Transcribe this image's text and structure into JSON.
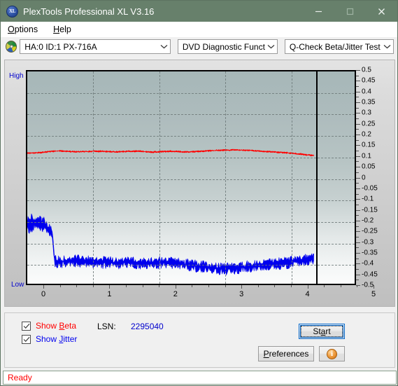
{
  "window": {
    "title": "PlexTools Professional XL V3.16",
    "icon": "XL",
    "buttons": {
      "minimize": "minimize-icon",
      "maximize": "maximize-icon",
      "close": "close-icon"
    },
    "titlebar_color": "#67806b"
  },
  "menubar": {
    "items": [
      {
        "label": "Options",
        "accel": "O"
      },
      {
        "label": "Help",
        "accel": "H"
      }
    ]
  },
  "toolbar": {
    "drive_icon": "disc-icon",
    "drive_select": "HA:0 ID:1  PX-716A",
    "function_select": "DVD Diagnostic Functions",
    "test_select": "Q-Check Beta/Jitter Test",
    "chevron": "chevron-down-icon"
  },
  "chart_data": {
    "type": "line",
    "title": "Q-Check Beta/Jitter Test",
    "xlabel": "",
    "ylabel": "",
    "xlim": [
      0,
      5
    ],
    "ylim": [
      -0.5,
      0.5
    ],
    "xticks": [
      0,
      1,
      2,
      3,
      4,
      5
    ],
    "xtick_labels": [
      "0",
      "1",
      "2",
      "3",
      "4",
      "5"
    ],
    "yticks": [
      0.5,
      0.45,
      0.4,
      0.35,
      0.3,
      0.25,
      0.2,
      0.15,
      0.1,
      0.05,
      0,
      -0.05,
      -0.1,
      -0.15,
      -0.2,
      -0.25,
      -0.3,
      -0.35,
      -0.4,
      -0.45,
      -0.5
    ],
    "ytick_labels": [
      "0.5",
      "0.45",
      "0.4",
      "0.35",
      "0.3",
      "0.25",
      "0.2",
      "0.15",
      "0.1",
      "0.05",
      "0",
      "-0.05",
      "-0.1",
      "-0.15",
      "-0.2",
      "-0.25",
      "-0.3",
      "-0.35",
      "-0.4",
      "-0.45",
      "-0.5"
    ],
    "grid": true,
    "grid_x_major": [
      1,
      2,
      3,
      4
    ],
    "grid_y_major": [
      0.4,
      0.3,
      0.2,
      0.1,
      0,
      -0.1,
      -0.2,
      -0.3,
      -0.4
    ],
    "axis_label_high": "High",
    "axis_label_low": "Low",
    "data_end_x": 4.38,
    "legend_position": "none",
    "series": [
      {
        "name": "Beta",
        "color": "#ff0000",
        "x": [
          0.0,
          0.1,
          0.2,
          0.3,
          0.4,
          0.5,
          0.6,
          0.7,
          0.8,
          0.9,
          1.0,
          1.1,
          1.2,
          1.3,
          1.4,
          1.5,
          1.6,
          1.7,
          1.8,
          1.9,
          2.0,
          2.1,
          2.2,
          2.3,
          2.4,
          2.5,
          2.6,
          2.7,
          2.8,
          2.9,
          3.0,
          3.1,
          3.2,
          3.3,
          3.4,
          3.5,
          3.6,
          3.7,
          3.8,
          3.9,
          4.0,
          4.1,
          4.2,
          4.3,
          4.38
        ],
        "values": [
          0.115,
          0.116,
          0.118,
          0.121,
          0.124,
          0.126,
          0.124,
          0.122,
          0.122,
          0.123,
          0.124,
          0.124,
          0.123,
          0.122,
          0.122,
          0.123,
          0.124,
          0.125,
          0.122,
          0.12,
          0.122,
          0.123,
          0.124,
          0.123,
          0.121,
          0.121,
          0.123,
          0.125,
          0.127,
          0.128,
          0.129,
          0.13,
          0.13,
          0.129,
          0.128,
          0.126,
          0.124,
          0.122,
          0.12,
          0.118,
          0.116,
          0.113,
          0.11,
          0.106,
          0.104
        ],
        "noise": 0.004
      },
      {
        "name": "Jitter",
        "color": "#0000ee",
        "x": [
          0.0,
          0.05,
          0.1,
          0.15,
          0.2,
          0.25,
          0.3,
          0.35,
          0.38,
          0.42,
          0.5,
          0.6,
          0.7,
          0.8,
          0.9,
          1.0,
          1.1,
          1.2,
          1.3,
          1.4,
          1.5,
          1.6,
          1.7,
          1.8,
          1.9,
          2.0,
          2.1,
          2.2,
          2.3,
          2.4,
          2.5,
          2.6,
          2.7,
          2.8,
          2.9,
          3.0,
          3.1,
          3.2,
          3.3,
          3.4,
          3.5,
          3.6,
          3.7,
          3.8,
          3.9,
          4.0,
          4.1,
          4.2,
          4.3,
          4.38
        ],
        "values": [
          -0.225,
          -0.215,
          -0.21,
          -0.208,
          -0.212,
          -0.22,
          -0.232,
          -0.25,
          -0.268,
          -0.392,
          -0.398,
          -0.392,
          -0.39,
          -0.392,
          -0.394,
          -0.396,
          -0.398,
          -0.399,
          -0.4,
          -0.4,
          -0.398,
          -0.399,
          -0.402,
          -0.404,
          -0.403,
          -0.4,
          -0.398,
          -0.4,
          -0.404,
          -0.408,
          -0.412,
          -0.416,
          -0.42,
          -0.424,
          -0.428,
          -0.43,
          -0.428,
          -0.424,
          -0.42,
          -0.416,
          -0.412,
          -0.408,
          -0.406,
          -0.404,
          -0.402,
          -0.398,
          -0.394,
          -0.39,
          -0.384,
          -0.378
        ],
        "noise": 0.03,
        "noise_head": 0.055
      }
    ]
  },
  "controls": {
    "show_beta": {
      "label_pre": "Show ",
      "accel": "B",
      "label_post": "eta",
      "checked": true,
      "color": "#ff0000"
    },
    "show_jitter": {
      "label_pre": "Show ",
      "accel": "J",
      "label_post": "itter",
      "checked": true,
      "color": "#0000ee"
    },
    "lsn_label": "LSN:",
    "lsn_value": "2295040",
    "start_button": {
      "pre": "St",
      "accel": "a",
      "post": "rt"
    },
    "preferences_button": {
      "pre": "",
      "accel": "P",
      "post": "references"
    },
    "info_button": "info-icon"
  },
  "statusbar": {
    "text": "Ready",
    "color": "#ff0000"
  }
}
